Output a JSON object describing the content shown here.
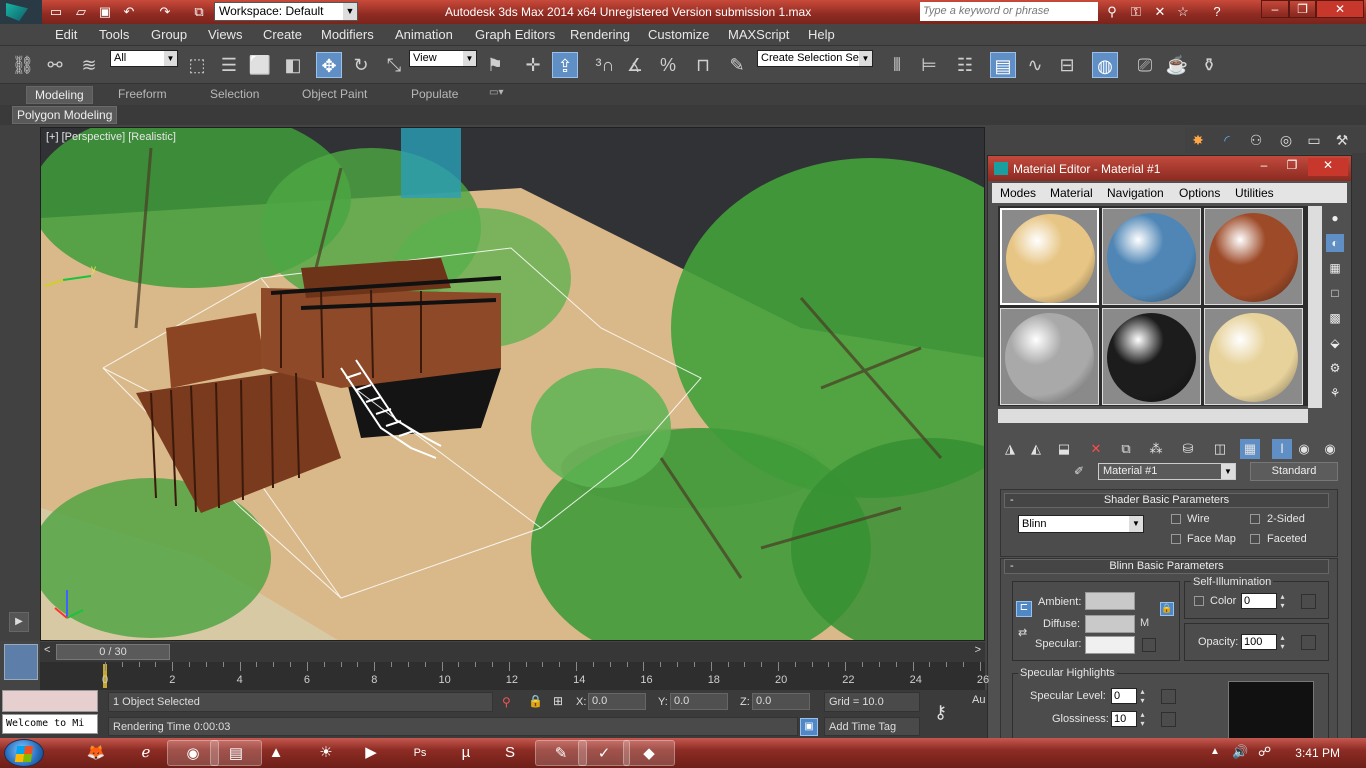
{
  "titlebar": {
    "title": "Autodesk 3ds Max  2014 x64    Unregistered Version    submission 1.max",
    "workspace": "Workspace: Default",
    "search_placeholder": "Type a keyword or phrase"
  },
  "menu": [
    "Edit",
    "Tools",
    "Group",
    "Views",
    "Create",
    "Modifiers",
    "Animation",
    "Graph Editors",
    "Rendering",
    "Customize",
    "MAXScript",
    "Help"
  ],
  "toolbar": {
    "selection_filter": "All",
    "reference_coord": "View",
    "named_selection": "Create Selection Se"
  },
  "ribbon": {
    "tabs": [
      "Modeling",
      "Freeform",
      "Selection",
      "Object Paint",
      "Populate"
    ],
    "active": "Modeling",
    "sub_panel": "Polygon Modeling"
  },
  "viewport": {
    "label": "[+] [Perspective] [Realistic]",
    "axis_y": "y"
  },
  "material_editor": {
    "title": "Material Editor - Material #1",
    "menu": [
      "Modes",
      "Material",
      "Navigation",
      "Options",
      "Utilities"
    ],
    "material_name": "Material #1",
    "material_type": "Standard",
    "shader_rollout": "Shader Basic Parameters",
    "shader": "Blinn",
    "wire": "Wire",
    "two_sided": "2-Sided",
    "face_map": "Face Map",
    "faceted": "Faceted",
    "blinn_rollout": "Blinn Basic Parameters",
    "self_illum": "Self-Illumination",
    "color_label": "Color",
    "color_value": "0",
    "ambient": "Ambient:",
    "diffuse": "Diffuse:",
    "specular": "Specular:",
    "m_button": "M",
    "opacity_label": "Opacity:",
    "opacity_value": "100",
    "spec_highlights": "Specular Highlights",
    "spec_level_label": "Specular Level:",
    "spec_level_value": "0",
    "gloss_label": "Glossiness:",
    "gloss_value": "10",
    "rollout_minus": "-",
    "spheres": [
      "#e7c584",
      "#4f86b5",
      "#9d4a28",
      "#a9a9a9",
      "#1c1c1c",
      "#e7d29b"
    ]
  },
  "timeline": {
    "frame_display": "0 / 30",
    "ticks": [
      "0",
      "2",
      "4",
      "6",
      "8",
      "10",
      "12",
      "14",
      "16",
      "18",
      "20",
      "22",
      "24",
      "26"
    ],
    "prev_arrow": "<",
    "next_arrow": ">"
  },
  "status": {
    "selected": "1 Object Selected",
    "render_time": "Rendering Time  0:00:03",
    "x_label": "X:",
    "x": "0.0",
    "y_label": "Y:",
    "y": "0.0",
    "z_label": "Z:",
    "z": "0.0",
    "grid": "Grid = 10.0",
    "add_time_tag": "Add Time Tag",
    "maxscript_listener": "Welcome to Mi",
    "auto_key": "Au"
  },
  "taskbar": {
    "time": "3:41 PM"
  }
}
